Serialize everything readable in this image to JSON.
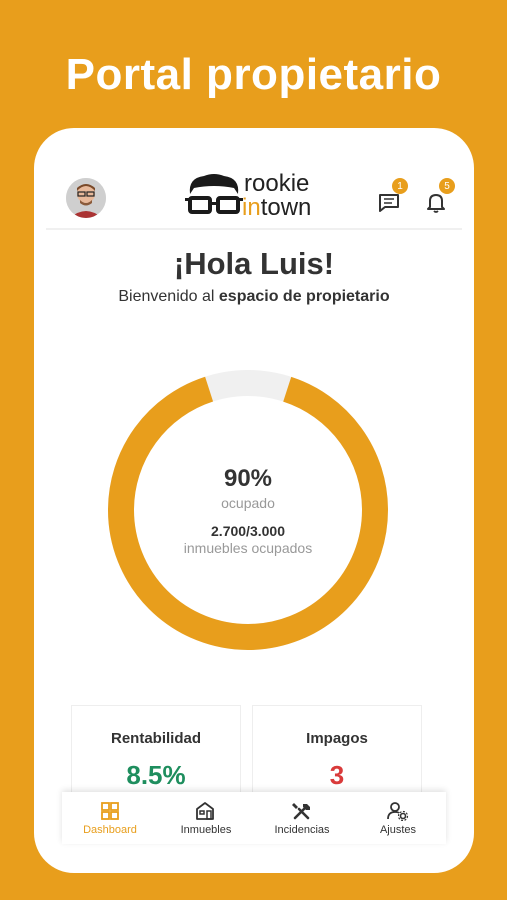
{
  "promo": {
    "title": "Portal propietario"
  },
  "header": {
    "logo_line1": "rookie",
    "logo_in": "in",
    "logo_town": "town",
    "messages_badge": "1",
    "notifications_badge": "5"
  },
  "greeting": {
    "title": "¡Hola Luis!",
    "subtitle_prefix": "Bienvenido al ",
    "subtitle_bold": "espacio de propietario"
  },
  "occupancy": {
    "percent_label": "90%",
    "percent_value": 90,
    "percent_caption": "ocupado",
    "count": "2.700/3.000",
    "count_caption": "inmuebles ocupados"
  },
  "cards": [
    {
      "title": "Rentabilidad",
      "value": "8.5%",
      "color": "#1E8E5E"
    },
    {
      "title": "Impagos",
      "value": "3",
      "color": "#D93A3A"
    }
  ],
  "tabs": [
    {
      "label": "Dashboard",
      "icon": "dashboard-icon",
      "active": true
    },
    {
      "label": "Inmuebles",
      "icon": "building-icon",
      "active": false
    },
    {
      "label": "Incidencias",
      "icon": "tools-icon",
      "active": false
    },
    {
      "label": "Ajustes",
      "icon": "user-settings-icon",
      "active": false
    }
  ],
  "colors": {
    "accent": "#E89E1C",
    "track": "#F0F0F0"
  }
}
